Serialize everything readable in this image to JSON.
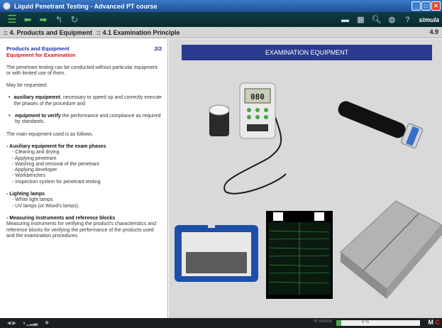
{
  "window": {
    "title": "Liquid Penetrant Testing - Advanced PT course"
  },
  "toolbar": {
    "brand": "simula"
  },
  "breadcrumb": {
    "chapter": ":: 4. Products and Equipment",
    "section": ":: 4.1 Examination Principle",
    "page": "4.9"
  },
  "left": {
    "heading": "Products and Equipment",
    "page_of": "2/2",
    "subheading": "Equipment for Examination",
    "intro": "The penetrant testing can be conducted without particular equipment or with limited use of them.",
    "may_be": "May be requested:",
    "bullets": [
      {
        "bold": "auxiliary equipment",
        "text": ", necessary to speed up and correctly execute the phases of the procedure and"
      },
      {
        "bold": "equipment to verify",
        "text": " the performance and compliance as required by standards."
      }
    ],
    "main_used": "The main equipment used is as follows.",
    "sections": [
      {
        "title": "- Auxiliary equipment for the exam phases",
        "items": [
          "- Cleaning and drying",
          "- Applying penetrant",
          "- Washing and removal of the penetrant",
          "- Applying developer",
          "- Workbenches",
          "- Inspection system for penetrant testing."
        ]
      },
      {
        "title": "- Lighting lamps",
        "items": [
          "- White light lamps",
          "- UV lamps (or Wood's lamps)."
        ]
      },
      {
        "title": "- Measuring instruments and reference blocks",
        "text": "Measuring instruments for verifying the product's characteristics and reference blocks for verifying the performance of the products used and the examination procedures."
      }
    ]
  },
  "right": {
    "title": "EXAMINATION EQUIPMENT",
    "meter_display": "080"
  },
  "bottom": {
    "progress_label": "% visione",
    "progress_value": "6 %",
    "progress_fraction": 0.06,
    "m": "M",
    "c": "C"
  }
}
